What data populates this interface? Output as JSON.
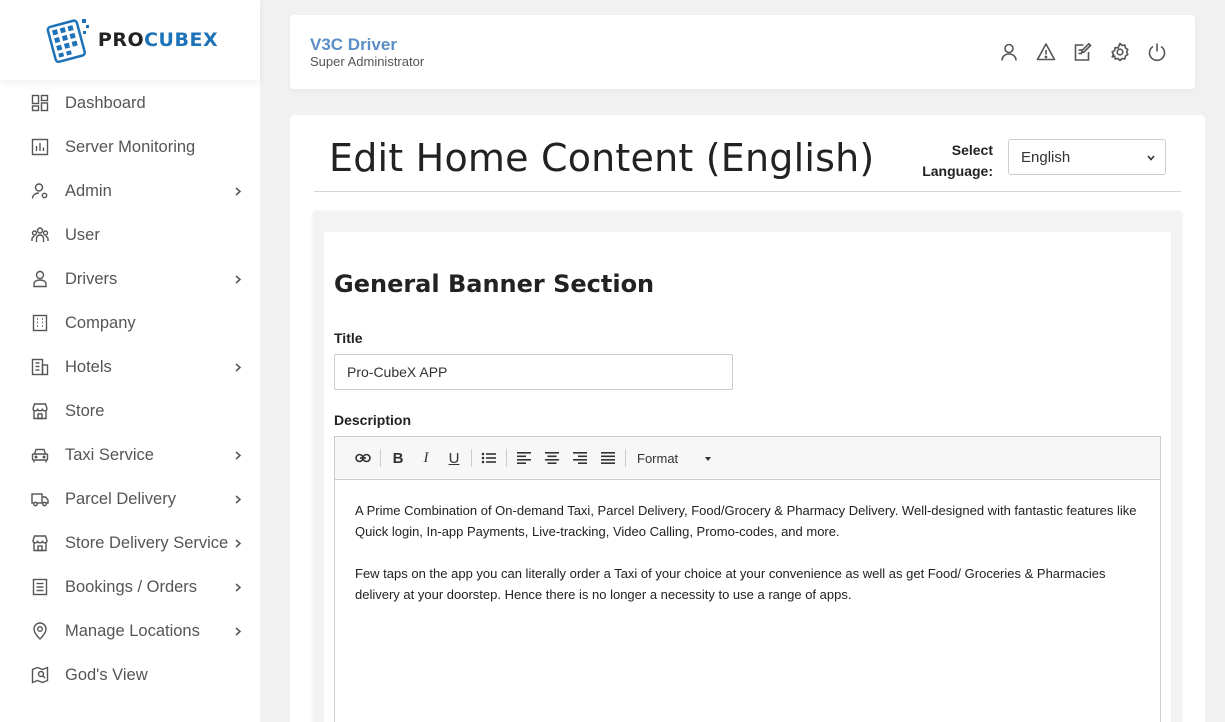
{
  "brand": {
    "pro": "PRO",
    "cubex": "CUBEX"
  },
  "colors": {
    "accent": "#5b8ec6",
    "brand_blue": "#1e72b8",
    "icon_gray": "#555555"
  },
  "sidebar": {
    "items": [
      {
        "label": "Dashboard",
        "icon": "dashboard-icon",
        "has_children": false
      },
      {
        "label": "Server Monitoring",
        "icon": "chart-icon",
        "has_children": false
      },
      {
        "label": "Admin",
        "icon": "admin-icon",
        "has_children": true
      },
      {
        "label": "User",
        "icon": "users-icon",
        "has_children": false
      },
      {
        "label": "Drivers",
        "icon": "driver-icon",
        "has_children": true
      },
      {
        "label": "Company",
        "icon": "building-icon",
        "has_children": false
      },
      {
        "label": "Hotels",
        "icon": "hotel-icon",
        "has_children": true
      },
      {
        "label": "Store",
        "icon": "store-icon",
        "has_children": false
      },
      {
        "label": "Taxi Service",
        "icon": "car-icon",
        "has_children": true
      },
      {
        "label": "Parcel Delivery",
        "icon": "truck-icon",
        "has_children": true
      },
      {
        "label": "Store Delivery Service",
        "icon": "store-icon",
        "has_children": true
      },
      {
        "label": "Bookings / Orders",
        "icon": "list-icon",
        "has_children": true
      },
      {
        "label": "Manage Locations",
        "icon": "location-icon",
        "has_children": true
      },
      {
        "label": "God's View",
        "icon": "map-icon",
        "has_children": false
      }
    ]
  },
  "header": {
    "user_name": "V3C Driver",
    "user_role": "Super Administrator",
    "icons": [
      "profile-icon",
      "alert-icon",
      "edit-icon",
      "settings-icon",
      "power-icon"
    ]
  },
  "main": {
    "page_title": "Edit Home Content (English)",
    "language_label_1": "Select",
    "language_label_2": "Language:",
    "language_value": "English",
    "section_title": "General Banner Section",
    "title_label": "Title",
    "title_value": "Pro-CubeX APP",
    "description_label": "Description",
    "format_label": "Format",
    "description_paragraphs": [
      "A Prime Combination of On-demand Taxi, Parcel Delivery, Food/Grocery & Pharmacy Delivery. Well-designed with fantastic features like Quick login, In-app Payments, Live-tracking, Video Calling, Promo-codes, and more.",
      "Few taps on the app you can literally order a Taxi of your choice at your convenience as well as get Food/ Groceries & Pharmacies delivery at your doorstep. Hence there is no longer a necessity to use a range of apps."
    ]
  }
}
